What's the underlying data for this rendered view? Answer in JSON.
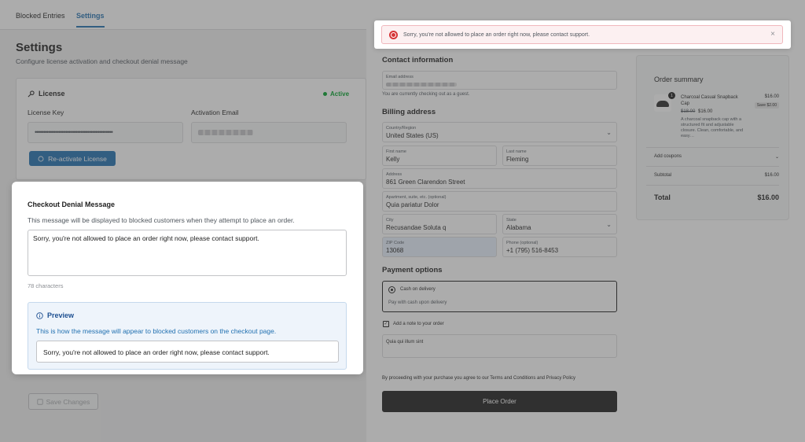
{
  "admin": {
    "tabs": [
      "Blocked Entries",
      "Settings"
    ],
    "page_title": "Settings",
    "page_desc": "Configure license activation and checkout denial message",
    "license": {
      "title": "License",
      "status": "Active",
      "key_label": "License Key",
      "key_value": "••••••••••••••••••••••••••••••••••••••••••••••",
      "email_label": "Activation Email",
      "reactivate_label": "Re-activate License"
    },
    "denial": {
      "title": "Checkout Denial Message",
      "description": "This message will be displayed to blocked customers when they attempt to place an order.",
      "message": "Sorry, you're not allowed to place an order right now, please contact support.",
      "char_count": "78 characters",
      "preview_title": "Preview",
      "preview_desc": "This is how the message will appear to blocked customers on the checkout page.",
      "preview_text": "Sorry, you're not allowed to place an order right now, please contact support."
    },
    "save_label": "Save Changes"
  },
  "checkout": {
    "notice": "Sorry, you're not allowed to place an order right now, please contact support.",
    "contact_title": "Contact information",
    "email_label": "Email address",
    "guest_note": "You are currently checking out as a guest.",
    "billing_title": "Billing address",
    "country_label": "Country/Region",
    "country_value": "United States (US)",
    "first_label": "First name",
    "first_value": "Kelly",
    "last_label": "Last name",
    "last_value": "Fleming",
    "address_label": "Address",
    "address_value": "861 Green Clarendon Street",
    "apt_label": "Apartment, suite, etc. (optional)",
    "apt_value": "Quia pariatur Dolor",
    "city_label": "City",
    "city_value": "Recusandae Soluta q",
    "state_label": "State",
    "state_value": "Alabama",
    "zip_label": "ZIP Code",
    "zip_value": "13068",
    "phone_label": "Phone (optional)",
    "phone_value": "+1 (795) 516-8453",
    "payment_title": "Payment options",
    "pay_method": "Cash on delivery",
    "pay_desc": "Pay with cash upon delivery",
    "note_label": "Add a note to your order",
    "note_value": "Quia qui illum sint",
    "terms": "By proceeding with your purchase you agree to our Terms and Conditions and Privacy Policy",
    "place_order": "Place Order",
    "summary": {
      "title": "Order summary",
      "qty": "1",
      "product_name": "Charcoal Casual Snapback Cap",
      "price": "$16.00",
      "old_price": "$18.00",
      "new_price": "$16.00",
      "save": "Save $2.00",
      "product_desc": "A charcoal snapback cap with a structured fit and adjustable closure. Clean, comfortable, and easy…",
      "coupons": "Add coupons",
      "subtotal_label": "Subtotal",
      "subtotal_value": "$16.00",
      "total_label": "Total",
      "total_value": "$16.00"
    }
  }
}
